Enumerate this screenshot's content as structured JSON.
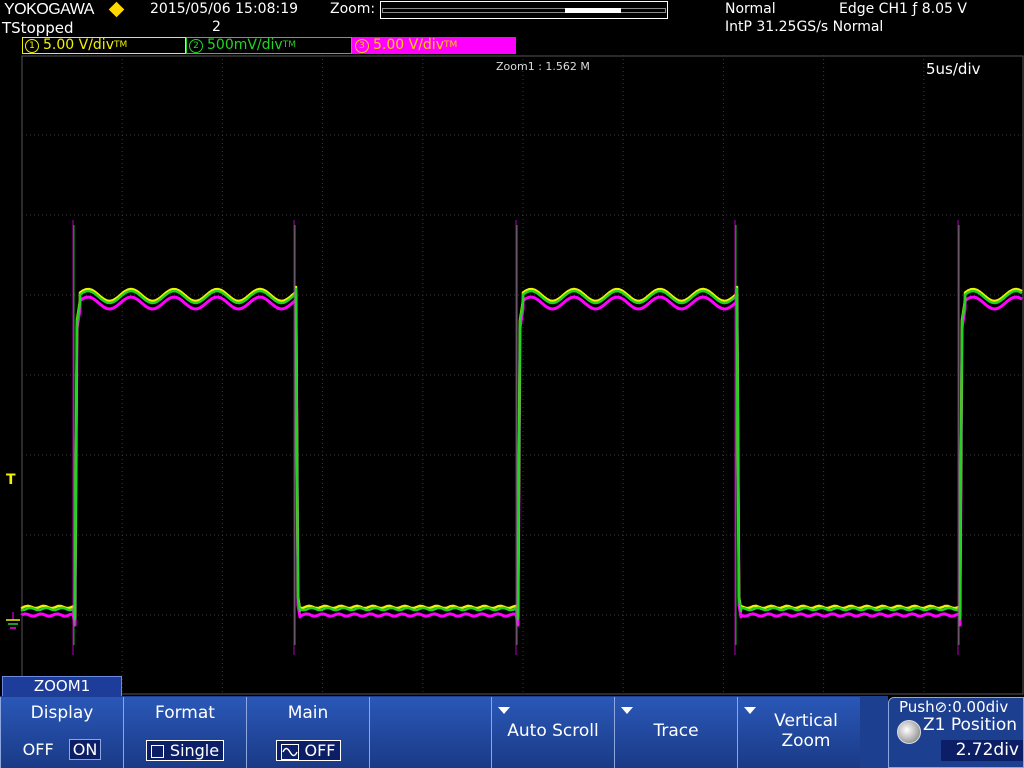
{
  "header": {
    "brand": "YOKOGAWA",
    "status": "TStopped",
    "datetime": "2015/05/06 15:08:19",
    "acq_count": "2",
    "zoom_label": "Zoom:",
    "trigger_mode": "Normal",
    "trigger_source": "Edge CH1 ƒ 8.05 V",
    "sampling": "IntP 31.25GS/s Normal"
  },
  "channels": [
    {
      "num": "1",
      "scale": "5.00 V/div",
      "sub": "TM",
      "color": "#f2f200"
    },
    {
      "num": "2",
      "scale": "500mV/div",
      "sub": "TM",
      "color": "#22d422"
    },
    {
      "num": "3",
      "scale": "5.00 V/div",
      "sub": "TM",
      "color": "#ff00ff"
    }
  ],
  "plot": {
    "zoom_info": "Zoom1 : 1.562 M",
    "time_div": "5us/div",
    "trigger_marker": "T"
  },
  "menu": {
    "tab": "ZOOM1",
    "display": {
      "title": "Display",
      "off": "OFF",
      "on": "ON"
    },
    "format": {
      "title": "Format",
      "value": "Single"
    },
    "main": {
      "title": "Main",
      "value": "OFF"
    },
    "auto_scroll": "Auto Scroll",
    "trace": "Trace",
    "vertical_zoom": "Vertical Zoom",
    "push": "Push⊘:0.00div",
    "z1_position_label": "Z1 Position",
    "z1_position_value": "2.72div"
  },
  "colors": {
    "ch1": "#f2f200",
    "ch2": "#22d422",
    "ch3": "#ff00ff",
    "grid": "#3a3a3a",
    "menu": "#1c3f90"
  }
}
